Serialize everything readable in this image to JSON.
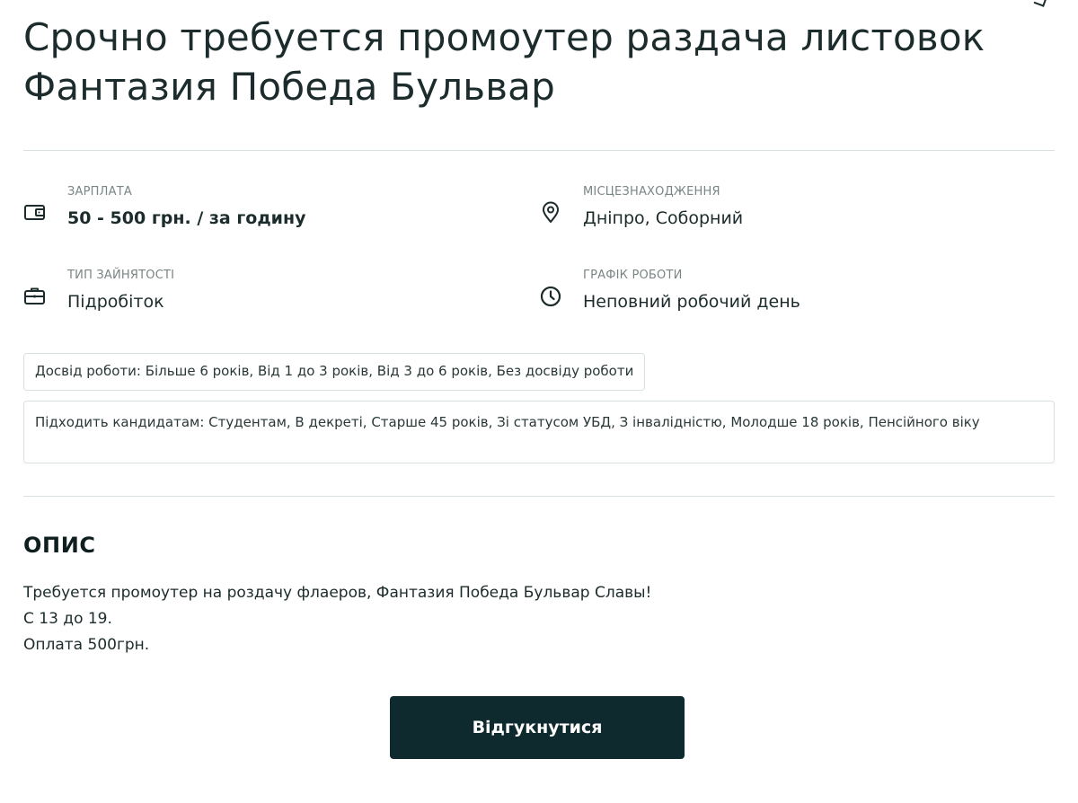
{
  "title": "Срочно требуется промоутер раздача листовок Фантазия Победа Бульвар",
  "facts": {
    "salary": {
      "label": "ЗАРПЛАТА",
      "value": "50 - 500 грн. / за годину",
      "icon": "wallet-icon"
    },
    "location": {
      "label": "МІСЦЕЗНАХОДЖЕННЯ",
      "value": "Дніпро, Соборний",
      "icon": "map-pin-icon"
    },
    "employment_type": {
      "label": "ТИП ЗАЙНЯТОСТІ",
      "value": "Підробіток",
      "icon": "briefcase-icon"
    },
    "schedule": {
      "label": "ГРАФІК РОБОТИ",
      "value": "Неповний робочий день",
      "icon": "clock-icon"
    }
  },
  "tags": {
    "experience": "Досвід роботи: Більше 6 років, Від 1 до 3 років, Від 3 до 6 років, Без досвіду роботи",
    "candidates": "Підходить кандидатам: Студентам, В декреті, Старше 45 років, Зі статусом УБД, З інвалідністю, Молодше 18 років, Пенсійного віку"
  },
  "description": {
    "heading": "ОПИС",
    "lines": [
      "Требуется промоутер на роздачу флаеров, Фантазия Победа Бульвар Славы!",
      "С 13 до 19.",
      "Оплата 500грн."
    ]
  },
  "apply_button": {
    "label": "Відгукнутися",
    "color": "#0e2a2f"
  }
}
